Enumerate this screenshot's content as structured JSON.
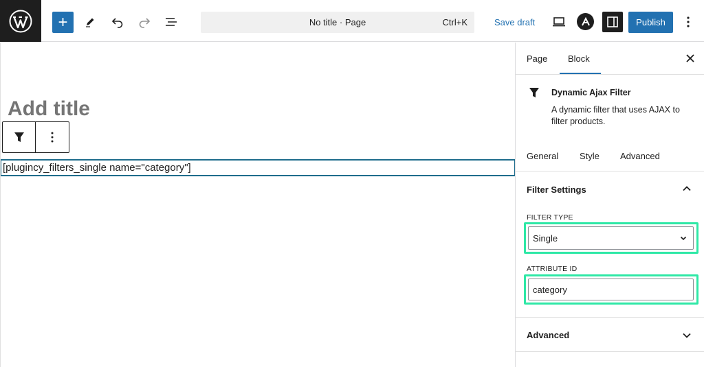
{
  "topbar": {
    "document_title": "No title · Page",
    "shortcut": "Ctrl+K",
    "save_draft": "Save draft",
    "publish": "Publish",
    "add_symbol": "+"
  },
  "editor": {
    "title_placeholder": "Add title",
    "shortcode": "[plugincy_filters_single name=\"category\"]"
  },
  "sidebar": {
    "tabs": [
      "Page",
      "Block"
    ],
    "active_tab": "Block",
    "block_name": "Dynamic Ajax Filter",
    "block_description": "A dynamic filter that uses AJAX to filter products.",
    "sub_tabs": [
      "General",
      "Style",
      "Advanced"
    ],
    "filter_settings": {
      "title": "Filter Settings",
      "filter_type_label": "FILTER TYPE",
      "filter_type_value": "Single",
      "attribute_id_label": "ATTRIBUTE ID",
      "attribute_id_value": "category"
    },
    "advanced_panel_title": "Advanced"
  },
  "colors": {
    "accent": "#2271b1",
    "highlight": "#2ee8a6",
    "dark": "#1e1e1e"
  }
}
